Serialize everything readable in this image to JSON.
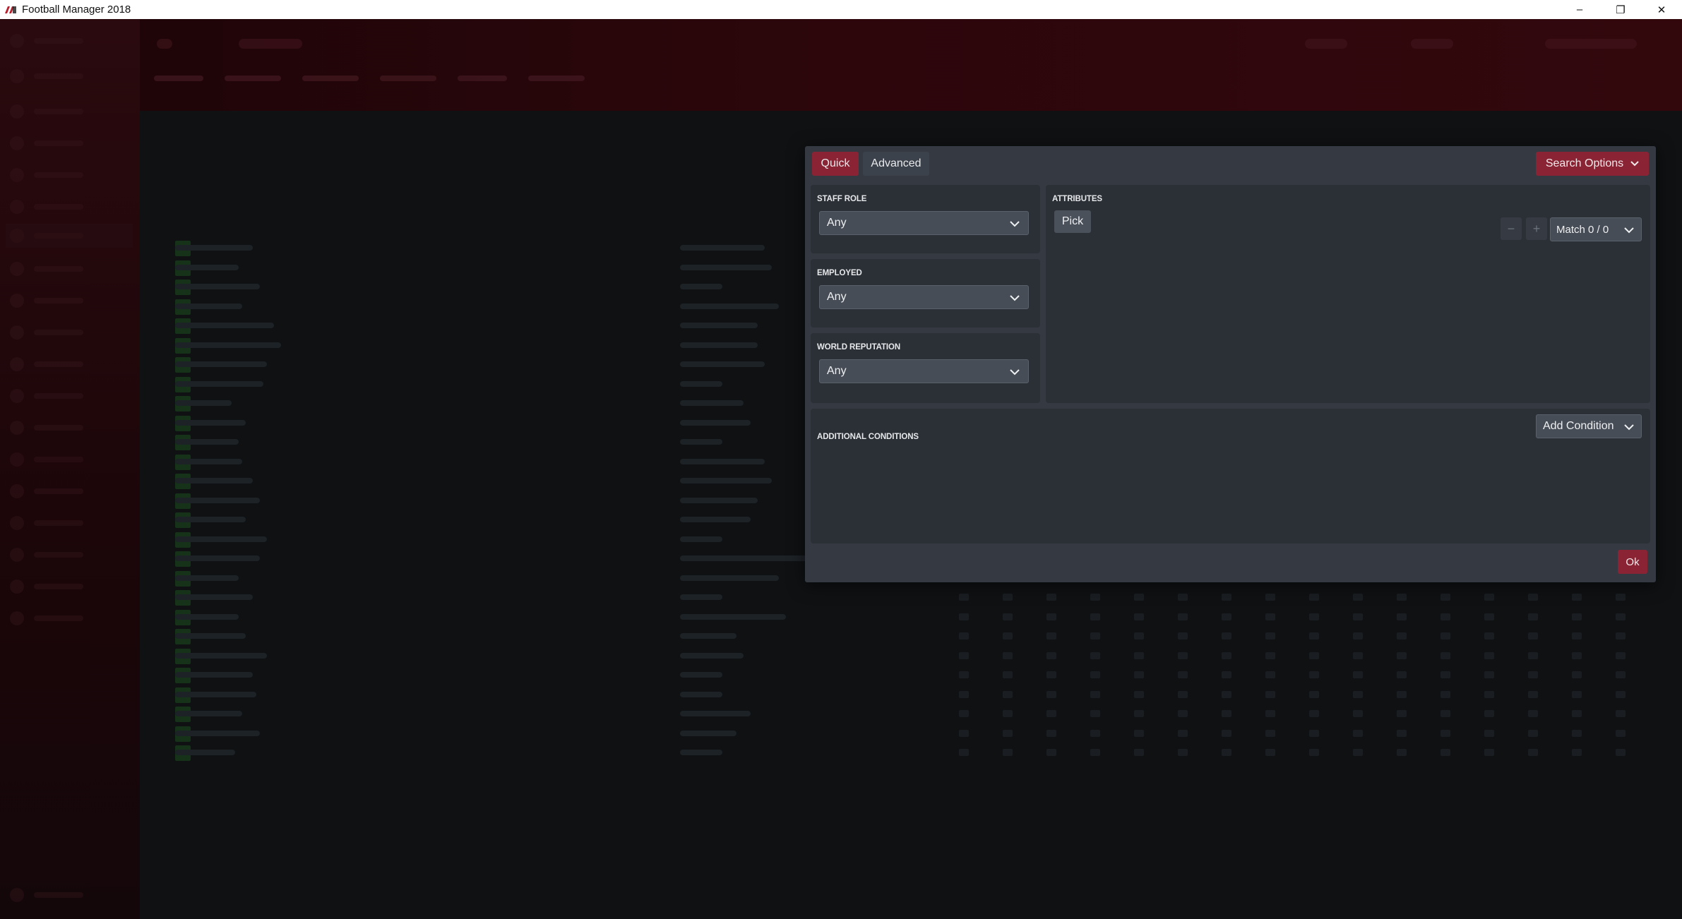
{
  "window": {
    "title": "Football Manager 2018",
    "controls": {
      "minimize": "–",
      "restore": "❐",
      "close": "✕"
    }
  },
  "dialog": {
    "tabs": [
      {
        "label": "Quick",
        "active": true
      },
      {
        "label": "Advanced",
        "active": false
      }
    ],
    "search_options_label": "Search Options",
    "staff_role": {
      "label": "STAFF ROLE",
      "value": "Any"
    },
    "employed": {
      "label": "EMPLOYED",
      "value": "Any"
    },
    "world_reputation": {
      "label": "WORLD REPUTATION",
      "value": "Any"
    },
    "attributes": {
      "label": "ATTRIBUTES",
      "pick_label": "Pick",
      "minus_label": "−",
      "plus_label": "+",
      "match_label": "Match 0 / 0"
    },
    "additional_conditions": {
      "label": "ADDITIONAL CONDITIONS",
      "add_condition_label": "Add Condition"
    },
    "ok_label": "Ok"
  },
  "colors": {
    "accent": "#8a2434",
    "dialog_bg": "#353a42",
    "panel_bg": "#2b3037",
    "select_bg": "#474d56"
  }
}
